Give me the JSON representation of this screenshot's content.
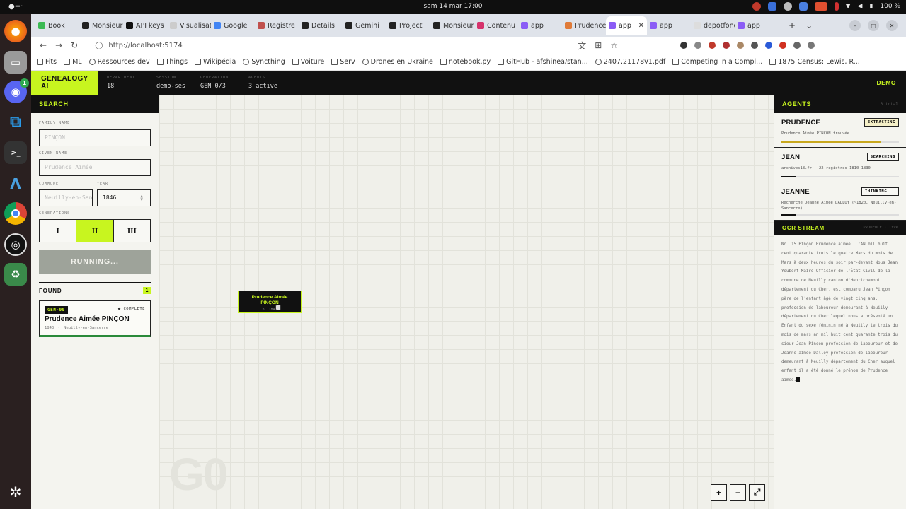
{
  "system": {
    "clock": "sam 14 mar  17:00",
    "battery": "100 %"
  },
  "dock": {
    "discord_badge": "1"
  },
  "browser": {
    "tabs": [
      {
        "label": "Book",
        "color": "#3cba54"
      },
      {
        "label": "Monsieur",
        "color": "#222222"
      },
      {
        "label": "API keys",
        "color": "#111111"
      },
      {
        "label": "Visualisatio",
        "color": "#cccccc"
      },
      {
        "label": "Google",
        "color": "#4285f4"
      },
      {
        "label": "Registre",
        "color": "#c0504d"
      },
      {
        "label": "Details",
        "color": "#222222"
      },
      {
        "label": "Gemini",
        "color": "#222222"
      },
      {
        "label": "Project",
        "color": "#222222"
      },
      {
        "label": "Monsieur",
        "color": "#222222"
      },
      {
        "label": "Contenu",
        "color": "#d6336c"
      },
      {
        "label": "app",
        "color": "#8b5cf6"
      },
      {
        "label": "Prudence",
        "color": "#e07b39"
      },
      {
        "label": "app",
        "color": "#8b5cf6"
      },
      {
        "label": "app",
        "color": "#8b5cf6"
      },
      {
        "label": "depotfond",
        "color": "#dddddd"
      },
      {
        "label": "app",
        "color": "#8b5cf6"
      }
    ],
    "url": "http://localhost:5174",
    "bookmarks": [
      "Fits",
      "ML",
      "Ressources dev",
      "Things",
      "Wikipédia",
      "Syncthing",
      "Voiture",
      "Serv",
      "Drones en Ukraine",
      "notebook.py",
      "GitHub - afshinea/stan...",
      "2407.21178v1.pdf",
      "Competing in a Compl...",
      "1875 Census: Lewis, R..."
    ]
  },
  "app": {
    "brand_line1": "GENEALOGY",
    "brand_line2": "AI",
    "header": {
      "department_label": "DEPARTMENT",
      "department": "18",
      "session_label": "SESSION",
      "session": "demo-ses",
      "generation_label": "GENERATION",
      "generation": "GEN 0/3",
      "agents_label": "AGENTS",
      "agents": "3 active",
      "demo": "DEMO"
    },
    "search": {
      "title": "SEARCH",
      "family_label": "FAMILY NAME",
      "family_placeholder": "PINÇON",
      "given_label": "GIVEN NAME",
      "given_placeholder": "Prudence Aimée",
      "commune_label": "COMMUNE",
      "commune_placeholder": "Neuilly-en-Sancerre",
      "year_label": "YEAR",
      "year_value": "1846",
      "generations_label": "GENERATIONS",
      "gen_options": [
        "I",
        "II",
        "III"
      ],
      "gen_selected": "II",
      "run_label": "RUNNING..."
    },
    "found": {
      "title": "FOUND",
      "count": "1",
      "card": {
        "gen": "GEN-00",
        "status": "● COMPLETE",
        "name": "Prudence Aimée PINÇON",
        "meta": "1843 · Neuilly-en-Sancerre"
      }
    },
    "canvas": {
      "node_name_line1": "Prudence Aimée",
      "node_name_line2": "PINÇON",
      "node_year": "b. 1843",
      "watermark": "G0",
      "zoom_in": "+",
      "zoom_out": "−",
      "fit": "⤢"
    },
    "agents_panel": {
      "title": "AGENTS",
      "count": "3 total",
      "agents": [
        {
          "name": "PRUDENCE",
          "status": "EXTRACTING",
          "message": "Prudence Aimée PINÇON trouvée",
          "progress": 0.85
        },
        {
          "name": "JEAN",
          "status": "SEARCHING",
          "message": "archives18.fr — 22 registres 1810-1830",
          "progress": 0.12
        },
        {
          "name": "JEANNE",
          "status": "THINKING...",
          "message": "Recherche Jeanne Aimée DALLOY (~1820, Neuilly-en-Sancerre)...",
          "progress": 0.12
        }
      ]
    },
    "ocr": {
      "title": "OCR STREAM",
      "source": "PRUDENCE · live",
      "text": "No. 15 Pinçon Prudence aimée. L'AN mil huit cent quarante trois le quatre Mars du mois de Mars à deux heures du soir par-devant Nous Jean Youbert Maire Officier de l'État Civil de la commune de Neuilly canton d'Henrichemont département du Cher, est comparu Jean Pinçon père de l'enfant âgé de vingt cinq ans, profession de laboureur demeurant à Neuilly département du Cher lequel nous a présenté un Enfant du sexe féminin né à Neuilly le trois du mois de mars an mil huit cent quarante trois du sieur Jean Pinçon profession de laboureur et de Jeanne aimée Dalloy profession de laboureur demeurant à Neuilly département du Cher auquel enfant il a été donné le prénom de Prudence aimée."
    }
  }
}
